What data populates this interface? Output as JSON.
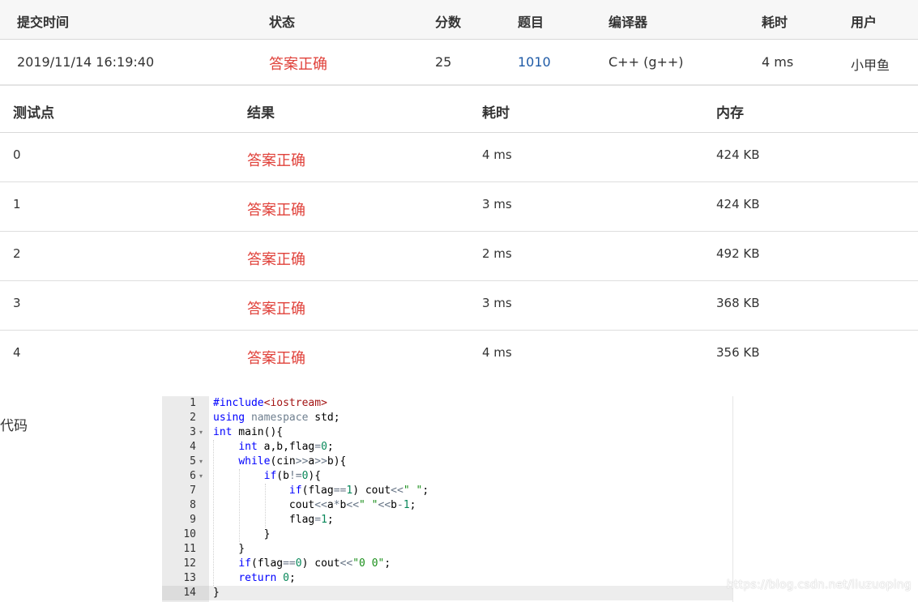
{
  "submission": {
    "headers": [
      "提交时间",
      "状态",
      "分数",
      "题目",
      "编译器",
      "耗时",
      "用户"
    ],
    "row": {
      "time": "2019/11/14 16:19:40",
      "status": "答案正确",
      "score": "25",
      "problem": "1010",
      "compiler": "C++ (g++)",
      "elapsed": "4 ms",
      "user": "小甲鱼"
    }
  },
  "cases": {
    "headers": [
      "测试点",
      "结果",
      "耗时",
      "内存"
    ],
    "rows": [
      {
        "id": "0",
        "result": "答案正确",
        "time": "4 ms",
        "memory": "424 KB"
      },
      {
        "id": "1",
        "result": "答案正确",
        "time": "3 ms",
        "memory": "424 KB"
      },
      {
        "id": "2",
        "result": "答案正确",
        "time": "2 ms",
        "memory": "492 KB"
      },
      {
        "id": "3",
        "result": "答案正确",
        "time": "3 ms",
        "memory": "368 KB"
      },
      {
        "id": "4",
        "result": "答案正确",
        "time": "4 ms",
        "memory": "356 KB"
      }
    ]
  },
  "code": {
    "label": "代码",
    "line_numbers": [
      "1",
      "2",
      "3",
      "4",
      "5",
      "6",
      "7",
      "8",
      "9",
      "10",
      "11",
      "12",
      "13",
      "14"
    ],
    "fold_markers": "▾",
    "active_line": 14
  },
  "watermark": "https://blog.csdn.net/liuzuoping",
  "colors": {
    "status_accept": "#e0413a",
    "problem_link": "#1e5aa6",
    "header_bg": "#f7f7f7",
    "gutter_bg": "#ebebeb"
  }
}
